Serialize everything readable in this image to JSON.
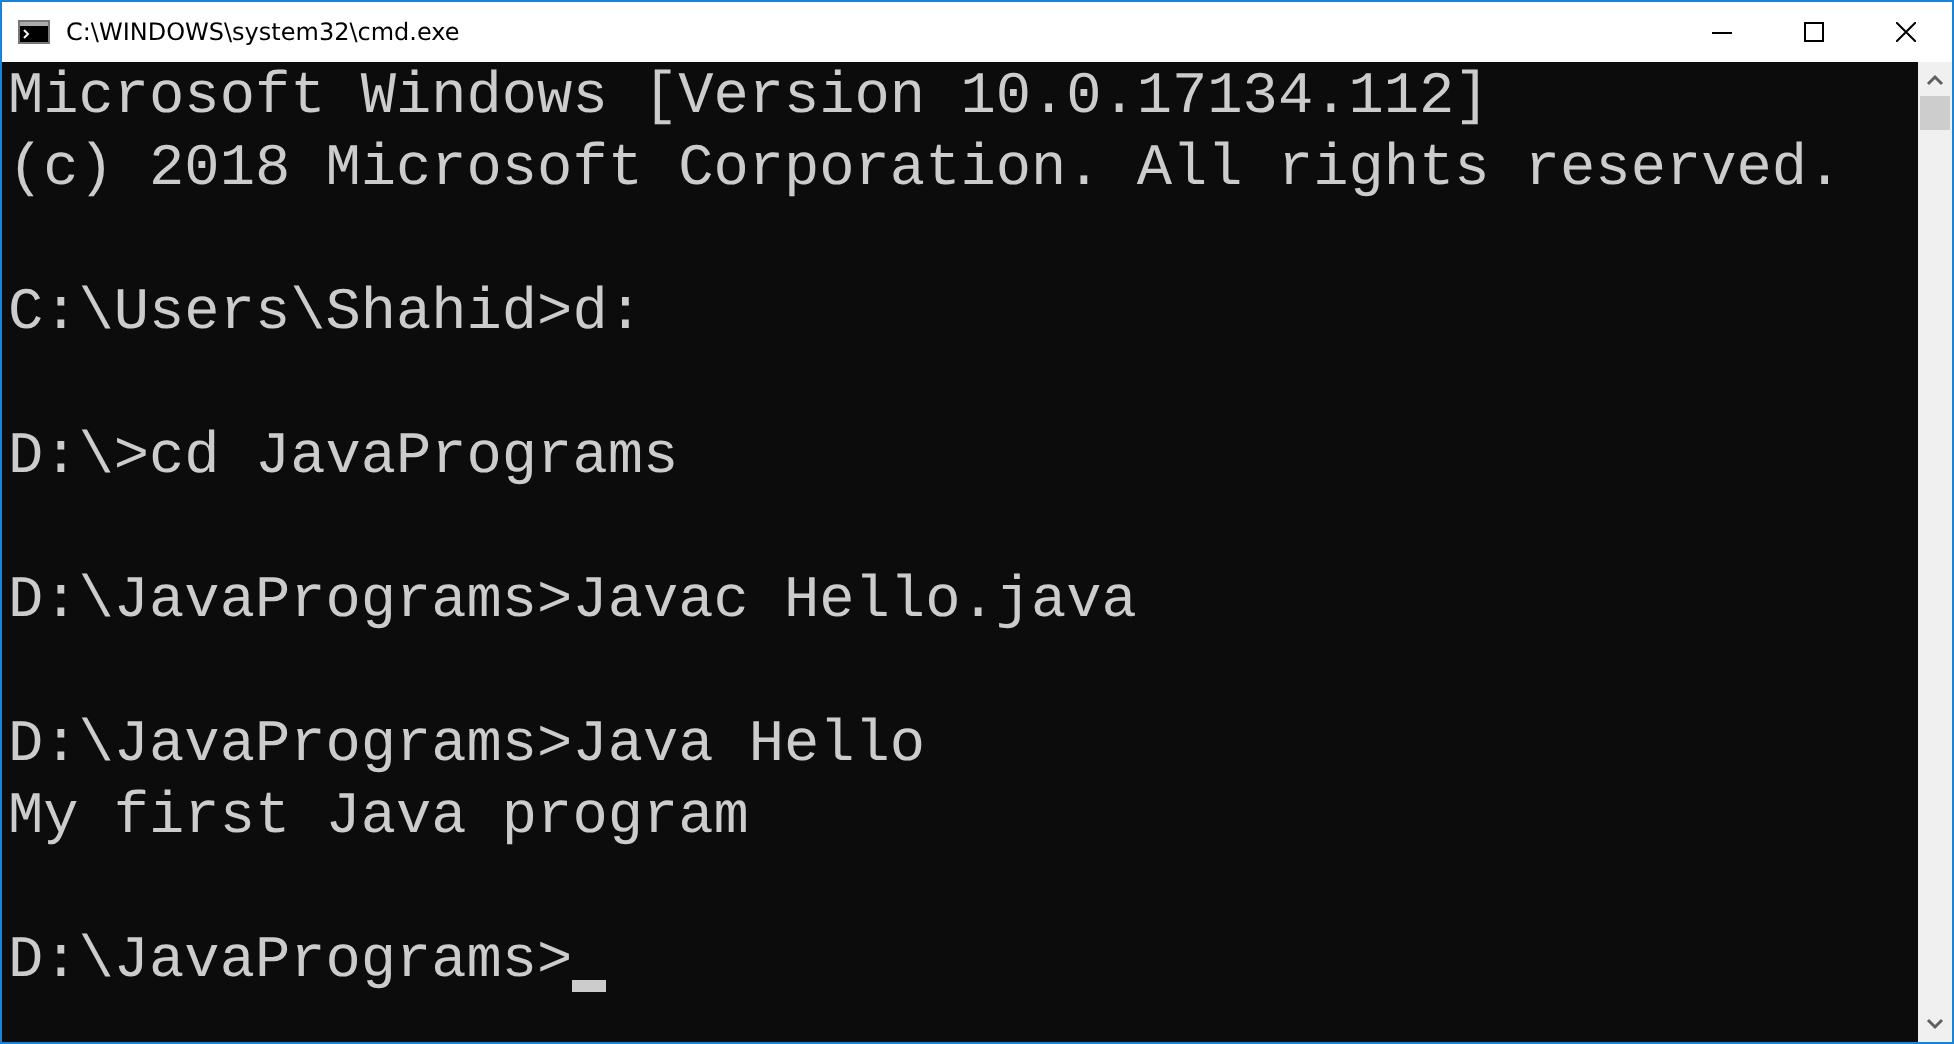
{
  "window": {
    "title": "C:\\WINDOWS\\system32\\cmd.exe"
  },
  "console": {
    "blocks": [
      [
        "Microsoft Windows [Version 10.0.17134.112]",
        "(c) 2018 Microsoft Corporation. All rights reserved."
      ],
      [
        "C:\\Users\\Shahid>d:"
      ],
      [
        "D:\\>cd JavaPrograms"
      ],
      [
        "D:\\JavaPrograms>Javac Hello.java"
      ],
      [
        "D:\\JavaPrograms>Java Hello",
        "My first Java program"
      ],
      [
        "D:\\JavaPrograms>"
      ]
    ]
  }
}
